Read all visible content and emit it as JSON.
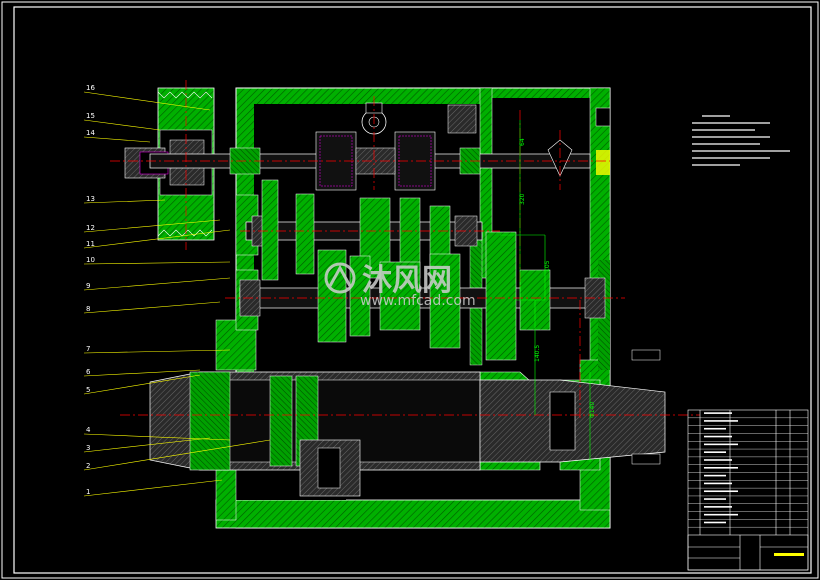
{
  "callouts": [
    "16",
    "15",
    "14",
    "13",
    "12",
    "11",
    "10",
    "9",
    "8",
    "7",
    "6",
    "5",
    "4",
    "3",
    "2",
    "1"
  ],
  "dimensions": {
    "d1": "64",
    "d2": "320",
    "d3": "105",
    "d4": "140.5",
    "d5": "Φ140"
  },
  "watermark": {
    "brand": "沐风网",
    "url": "www.mfcad.com"
  },
  "colors": {
    "background": "#000000",
    "housing_green": "#00c000",
    "outline": "#ffffff",
    "center_line": "#ff0000",
    "dimension": "#00ff00",
    "leader": "#ffff00",
    "part_blue": "#4040ff",
    "part_magenta": "#ff00ff"
  }
}
